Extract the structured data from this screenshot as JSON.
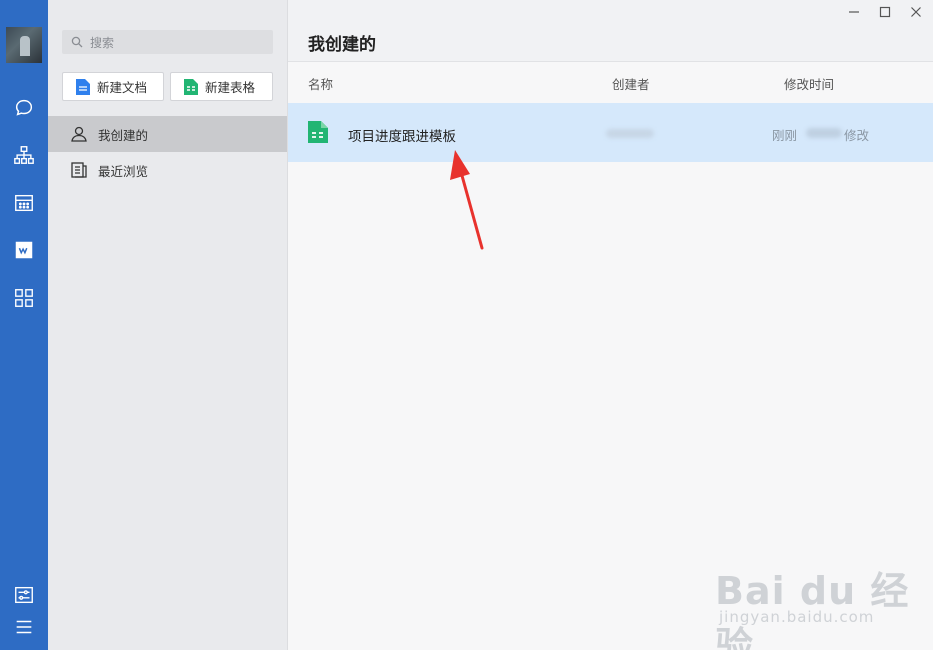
{
  "sidebar": {
    "search_placeholder": "搜索",
    "new_doc_label": "新建文档",
    "new_sheet_label": "新建表格",
    "nav": [
      {
        "label": "我创建的",
        "icon": "person-icon",
        "active": true
      },
      {
        "label": "最近浏览",
        "icon": "recent-doc-icon",
        "active": false
      }
    ]
  },
  "main": {
    "title": "我创建的",
    "columns": {
      "name": "名称",
      "creator": "创建者",
      "modified": "修改时间"
    },
    "rows": [
      {
        "name": "项目进度跟进模板",
        "creator": "",
        "modified_prefix": "刚刚",
        "modified_suffix": "修改"
      }
    ]
  },
  "watermark": {
    "main": "Bai du 经验",
    "sub": "jingyan.baidu.com"
  },
  "colors": {
    "rail": "#2e6cc4",
    "sidebar": "#e9eaed",
    "selected_row": "#d5e8fb",
    "doc_icon": "#2f80ed",
    "sheet_icon": "#22b573",
    "arrow": "#e8322d"
  }
}
